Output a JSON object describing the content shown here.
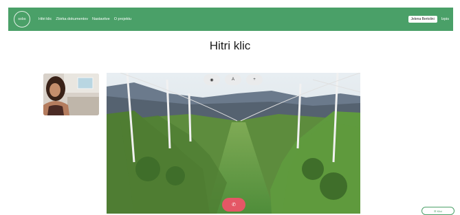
{
  "nav": {
    "logo_text": "sobs",
    "links": [
      "Hitri klic",
      "Zbirka dokumentov",
      "Nastavitve",
      "O projektu"
    ],
    "user": "Jelena Bertolini",
    "logout": "Izpis"
  },
  "main": {
    "title": "Hitri klic"
  },
  "video": {
    "overlay_buttons": [
      "◉",
      "A",
      "+"
    ],
    "action_label": "✆"
  },
  "corner_button": {
    "label": "☰ Klici"
  },
  "colors": {
    "accent": "#4aa068",
    "danger": "#e45766"
  }
}
